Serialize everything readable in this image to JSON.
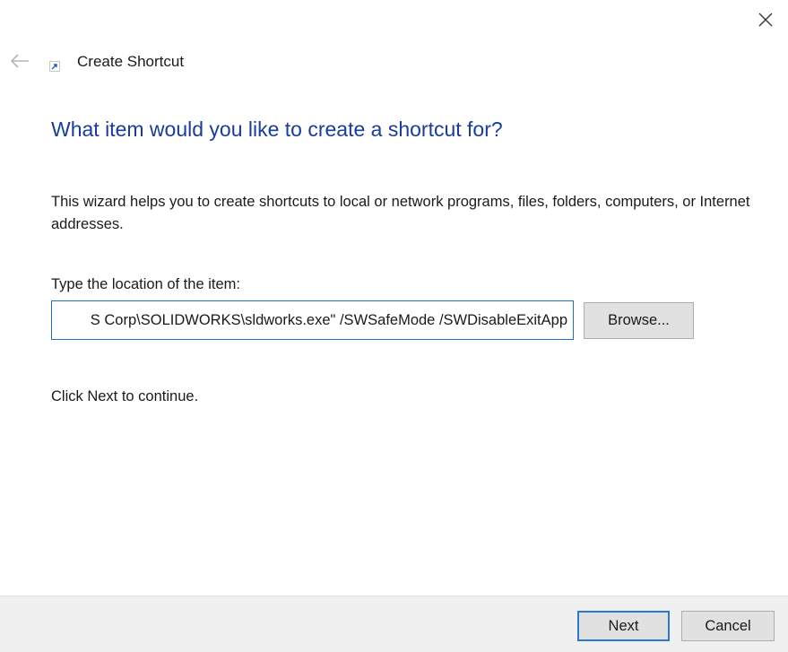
{
  "window": {
    "title": "Create Shortcut",
    "close_icon": "close-icon",
    "back_icon": "arrow-left-icon",
    "app_icon": "shortcut-icon"
  },
  "main": {
    "heading": "What item would you like to create a shortcut for?",
    "description": "This wizard helps you to create shortcuts to local or network programs, files, folders, computers, or Internet addresses.",
    "location_label": "Type the location of the item:",
    "location_value": "S Corp\\SOLIDWORKS\\sldworks.exe\" /SWSafeMode /SWDisableExitApp",
    "browse_label": "Browse...",
    "continue_text": "Click Next to continue."
  },
  "footer": {
    "next_label": "Next",
    "cancel_label": "Cancel"
  },
  "colors": {
    "heading": "#1a3c9c",
    "input_border": "#1a73c8",
    "default_button_border": "#2a78d0",
    "footer_background": "#f0f0f0"
  }
}
